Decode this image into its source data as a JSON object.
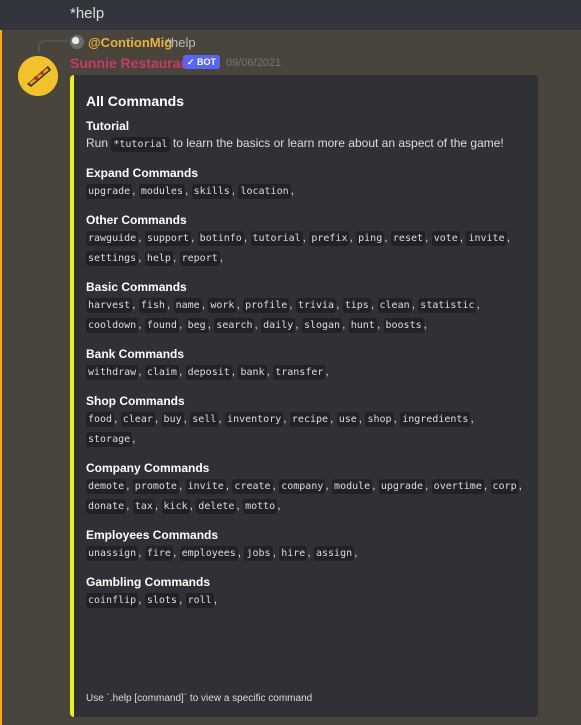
{
  "previous_message": {
    "text": "*help"
  },
  "reply": {
    "username": "@ContionMig",
    "text": "*help"
  },
  "message": {
    "username": "Sunnie Restaurant",
    "bot_tag": "✓ BOT",
    "timestamp": "09/06/2021"
  },
  "embed": {
    "title": "All Commands",
    "accent_color": "#e8f01e",
    "tutorial": {
      "name": "Tutorial",
      "prefix": "Run ",
      "code": "*tutorial",
      "suffix": " to learn the basics or learn more about an aspect of the game!"
    },
    "fields": [
      {
        "name": "Expand Commands",
        "commands": [
          "upgrade",
          "modules",
          "skills",
          "location"
        ]
      },
      {
        "name": "Other Commands",
        "commands": [
          "rawguide",
          "support",
          "botinfo",
          "tutorial",
          "prefix",
          "ping",
          "reset",
          "vote",
          "invite",
          "settings",
          "help",
          "report"
        ]
      },
      {
        "name": "Basic Commands",
        "commands": [
          "harvest",
          "fish",
          "name",
          "work",
          "profile",
          "trivia",
          "tips",
          "clean",
          "statistic",
          "cooldown",
          "found",
          "beg",
          "search",
          "daily",
          "slogan",
          "hunt",
          "boosts"
        ]
      },
      {
        "name": "Bank Commands",
        "commands": [
          "withdraw",
          "claim",
          "deposit",
          "bank",
          "transfer"
        ]
      },
      {
        "name": "Shop Commands",
        "commands": [
          "food",
          "clear",
          "buy",
          "sell",
          "inventory",
          "recipe",
          "use",
          "shop",
          "ingredients",
          "storage"
        ]
      },
      {
        "name": "Company Commands",
        "commands": [
          "demote",
          "promote",
          "invite",
          "create",
          "company",
          "module",
          "upgrade",
          "overtime",
          "corp",
          "donate",
          "tax",
          "kick",
          "delete",
          "motto"
        ]
      },
      {
        "name": "Employees Commands",
        "commands": [
          "unassign",
          "fire",
          "employees",
          "jobs",
          "hire",
          "assign"
        ]
      },
      {
        "name": "Gambling Commands",
        "commands": [
          "coinflip",
          "slots",
          "roll"
        ]
      }
    ],
    "footer": "Use `.help [command]` to view a specific command"
  },
  "colors": {
    "background": "#36393f",
    "highlight": "#49443c",
    "embed_bg": "#2f3136",
    "username": "#c93a67",
    "reply_user": "#e3b341",
    "bot_tag": "#5865f2"
  }
}
